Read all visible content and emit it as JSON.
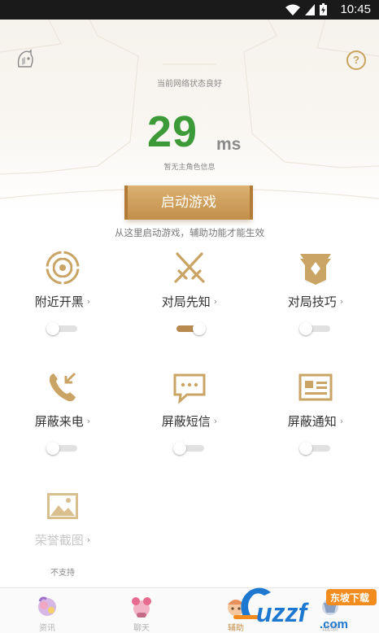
{
  "status_bar": {
    "time": "10:45",
    "icons": [
      "wifi-icon",
      "signal-icon",
      "battery-charging-icon"
    ]
  },
  "header": {
    "logo_icon": "helmet-logo-icon",
    "help_icon": "help-circle-icon",
    "help_glyph": "?"
  },
  "network": {
    "status": "当前网络状态良好",
    "ping": "29",
    "unit": "ms",
    "role_info": "暂无主角色信息"
  },
  "start": {
    "label": "启动游戏",
    "hint": "从这里启动游戏，辅助功能才能生效"
  },
  "features": [
    {
      "label": "附近开黑",
      "icon": "radar-icon",
      "enabled": false,
      "supported": true
    },
    {
      "label": "对局先知",
      "icon": "crossed-swords-icon",
      "enabled": true,
      "supported": true
    },
    {
      "label": "对局技巧",
      "icon": "banner-icon",
      "enabled": false,
      "supported": true
    },
    {
      "label": "屏蔽来电",
      "icon": "incoming-call-icon",
      "enabled": false,
      "supported": true
    },
    {
      "label": "屏蔽短信",
      "icon": "message-icon",
      "enabled": false,
      "supported": true
    },
    {
      "label": "屏蔽通知",
      "icon": "notification-card-icon",
      "enabled": false,
      "supported": true
    },
    {
      "label": "荣誉截图",
      "icon": "image-icon",
      "enabled": false,
      "supported": false,
      "note": "不支持"
    }
  ],
  "chevron": "›",
  "tabs": [
    {
      "label": "资讯",
      "icon": "news-character-icon",
      "active": false
    },
    {
      "label": "聊天",
      "icon": "chat-character-icon",
      "active": false
    },
    {
      "label": "辅助",
      "icon": "assist-character-icon",
      "active": true
    },
    {
      "label": "战绩",
      "icon": "record-character-icon",
      "active": false
    }
  ],
  "watermark": {
    "brand": "uzzf",
    "domain": ".com",
    "tag": "东坡下载"
  },
  "colors": {
    "accent": "#c28f4a",
    "ping_green": "#3d9a39",
    "toggle_on": "#b98a4f"
  }
}
